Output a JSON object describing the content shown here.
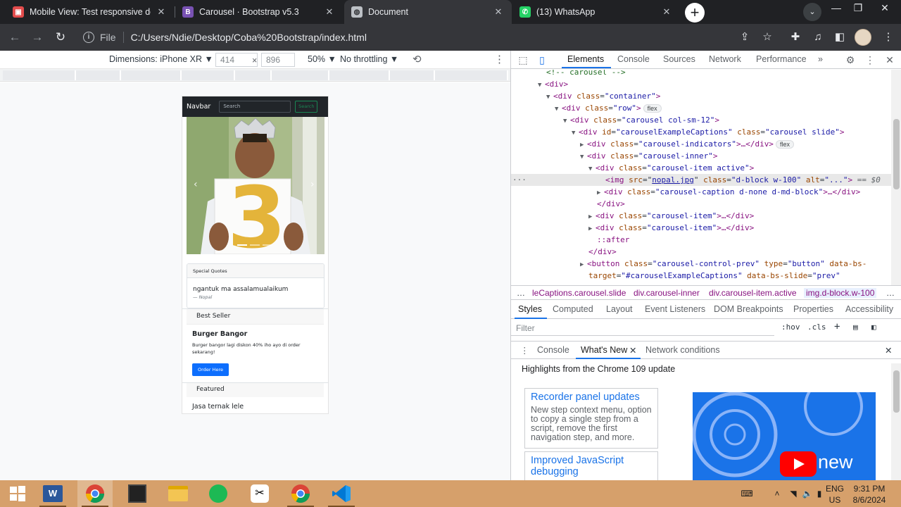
{
  "browser": {
    "tabs": [
      {
        "title": "Mobile View: Test responsive des",
        "favicon_color": "#e34c4c",
        "favicon_glyph": "▣"
      },
      {
        "title": "Carousel · Bootstrap v5.3",
        "favicon_color": "#7952b3",
        "favicon_glyph": "B"
      },
      {
        "title": "Document",
        "favicon_color": "#bdc1c6",
        "favicon_glyph": "◍"
      },
      {
        "title": "(13) WhatsApp",
        "favicon_color": "#25d366",
        "favicon_glyph": "✆"
      }
    ],
    "file_label": "File",
    "url": "C:/Users/Ndie/Desktop/Coba%20Bootstrap/index.html"
  },
  "emulation": {
    "device": "Dimensions: iPhone XR ▼",
    "width": "414",
    "height": "896",
    "times": "×",
    "zoom": "50% ▼",
    "throttle": "No throttling ▼"
  },
  "phone": {
    "navbar": {
      "brand": "Navbar",
      "search_placeholder": "Search",
      "search_button": "Search"
    },
    "quote_card": {
      "header": "Special Quotes",
      "quote": "ngantuk ma assalamualaikum",
      "author": "— Nopal"
    },
    "best_seller": {
      "header": "Best Seller",
      "title": "Burger Bangor",
      "text": "Burger bangor lagi diskon 40% iho ayo di order sekarang!",
      "button": "Order Here"
    },
    "featured": {
      "header": "Featured",
      "title": "Jasa ternak lele"
    }
  },
  "devtools": {
    "tabs": [
      "Elements",
      "Console",
      "Sources",
      "Network",
      "Performance",
      "»"
    ],
    "code": {
      "l0": "<!-- carousel -->",
      "l1_tag": "<div>",
      "l2_tag": "<div ",
      "l2_attr": "class",
      "l2_val": "\"container\"",
      "l2_end": ">",
      "l3_tag": "<div ",
      "l3_attr": "class",
      "l3_val": "\"row\"",
      "l3_end": ">",
      "flex": "flex",
      "l4_tag": "<div ",
      "l4_attr": "class",
      "l4_val": "\"carousel col-sm-12\"",
      "l4_end": ">",
      "l5_tag": "<div ",
      "l5_attr1": "id",
      "l5_val1": "\"carouselExampleCaptions\"",
      "l5_attr2": " class",
      "l5_val2": "\"carousel slide\"",
      "l5_end": ">",
      "l6_tag": "<div ",
      "l6_attr": "class",
      "l6_val": "\"carousel-indicators\"",
      "l6_end": ">…</div>",
      "l7_tag": "<div ",
      "l7_attr": "class",
      "l7_val": "\"carousel-inner\"",
      "l7_end": ">",
      "l8_tag": "<div ",
      "l8_attr": "class",
      "l8_val": "\"carousel-item active\"",
      "l8_end": ">",
      "l9_tag": "<img ",
      "l9_attr1": "src",
      "l9_link": "nopal.jpg",
      "l9_attr2": " class",
      "l9_val2": "\"d-block w-100\"",
      "l9_attr3": " alt",
      "l9_val3": "\"...\"",
      "l9_end": ">",
      "l9_eq": " == $0",
      "l10_tag": "<div ",
      "l10_attr": "class",
      "l10_val": "\"carousel-caption d-none d-md-block\"",
      "l10_end": ">…</div>",
      "l11": "</div>",
      "l12_tag": "<div ",
      "l12_attr": "class",
      "l12_val": "\"carousel-item\"",
      "l12_end": ">…</div>",
      "l13_tag": "<div ",
      "l13_attr": "class",
      "l13_val": "\"carousel-item\"",
      "l13_end": ">…</div>",
      "l14": "::after",
      "l15": "</div>",
      "l16_tag": "<button ",
      "l16_attr1": "class",
      "l16_val1": "\"carousel-control-prev\"",
      "l16_attr2": " type",
      "l16_val2": "\"button\"",
      "l16_attr3": " data-bs-",
      "l17_attr": "target",
      "l17_val": "\"#carouselExampleCaptions\"",
      "l17_attr2": " data-bs-slide",
      "l17_val2": "\"prev\""
    },
    "breadcrumbs": [
      "…",
      "leCaptions.carousel.slide",
      "div.carousel-inner",
      "div.carousel-item.active",
      "img.d-block.w-100",
      "…"
    ],
    "styles_tabs": [
      "Styles",
      "Computed",
      "Layout",
      "Event Listeners",
      "DOM Breakpoints",
      "Properties",
      "Accessibility"
    ],
    "filter_placeholder": "Filter",
    "hov": ":hov",
    "cls": ".cls",
    "drawer_tabs": [
      "Console",
      "What's New",
      "Network conditions"
    ],
    "whats_new": {
      "title": "Highlights from the Chrome 109 update",
      "card1_title": "Recorder panel updates",
      "card1_body": "New step context menu, option to copy a single step from a script, remove the first navigation step, and more.",
      "card2_title": "Improved JavaScript debugging",
      "video_text": "new"
    }
  },
  "taskbar": {
    "lang1": "ENG",
    "lang2": "US",
    "time": "9:31 PM",
    "date": "8/6/2024"
  }
}
